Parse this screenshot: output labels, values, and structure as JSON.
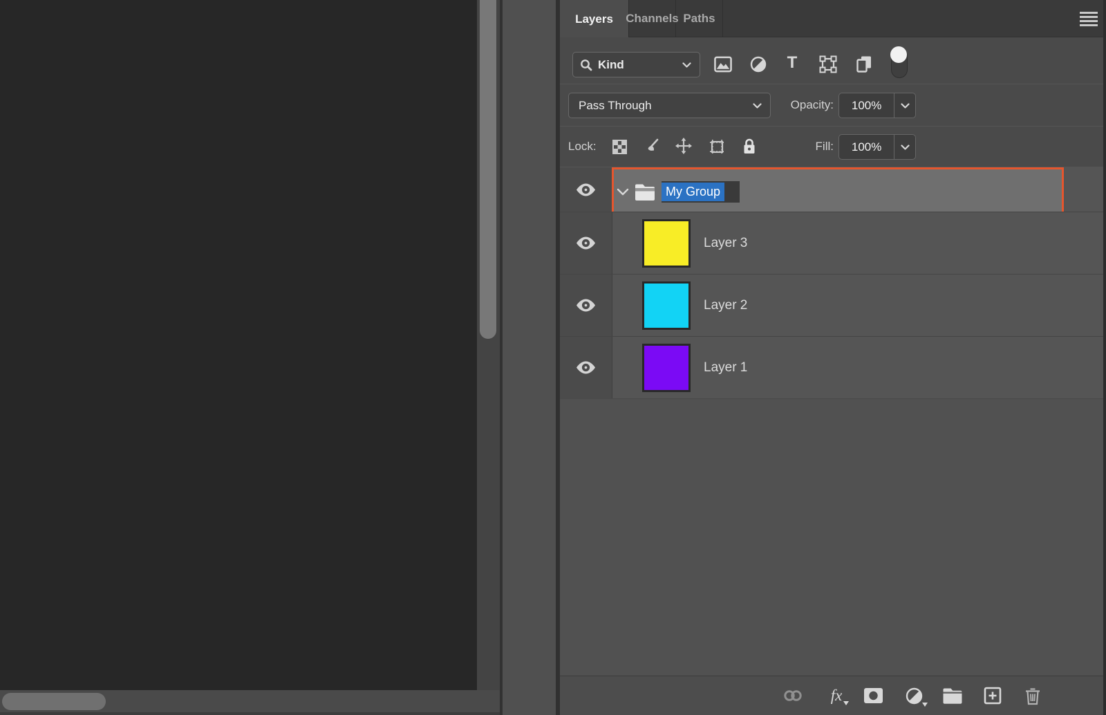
{
  "colors": {
    "accent_orange": "#E5562E",
    "selection_blue": "#2B72C3",
    "canvas_bg": "#272727",
    "panel_bg": "#4A4A4A",
    "selected_row_bg": "#6F6F6F"
  },
  "panel": {
    "tabs": {
      "layers": "Layers",
      "channels": "Channels",
      "paths": "Paths"
    },
    "filter": {
      "kind_label": "Kind",
      "type_glyph": "T",
      "icons": [
        "search-icon",
        "pixel-layer-filter-icon",
        "adjustment-layer-filter-icon",
        "type-layer-filter-icon",
        "shape-layer-filter-icon",
        "smart-object-filter-icon",
        "filter-toggle-switch"
      ]
    },
    "blend": {
      "mode": "Pass Through",
      "opacity_label": "Opacity:",
      "opacity_value": "100%"
    },
    "lock": {
      "label": "Lock:",
      "fill_label": "Fill:",
      "fill_value": "100%",
      "icons": [
        "lock-transparency-icon",
        "lock-pixels-icon",
        "lock-position-icon",
        "lock-artboard-icon",
        "lock-all-icon"
      ]
    },
    "layers": {
      "group": {
        "name": "My Group"
      },
      "items": [
        {
          "name": "Layer 3",
          "color": "#F8ED26"
        },
        {
          "name": "Layer 2",
          "color": "#12D3F5"
        },
        {
          "name": "Layer 1",
          "color": "#7B0AF5"
        }
      ]
    },
    "bottom_bar": {
      "fx_label": "fx",
      "icons": [
        "link-layers-icon",
        "layer-style-icon",
        "add-mask-icon",
        "adjustment-layer-icon",
        "new-group-icon",
        "new-layer-icon",
        "delete-layer-icon"
      ]
    },
    "menu_icon": "panel-menu-icon"
  }
}
